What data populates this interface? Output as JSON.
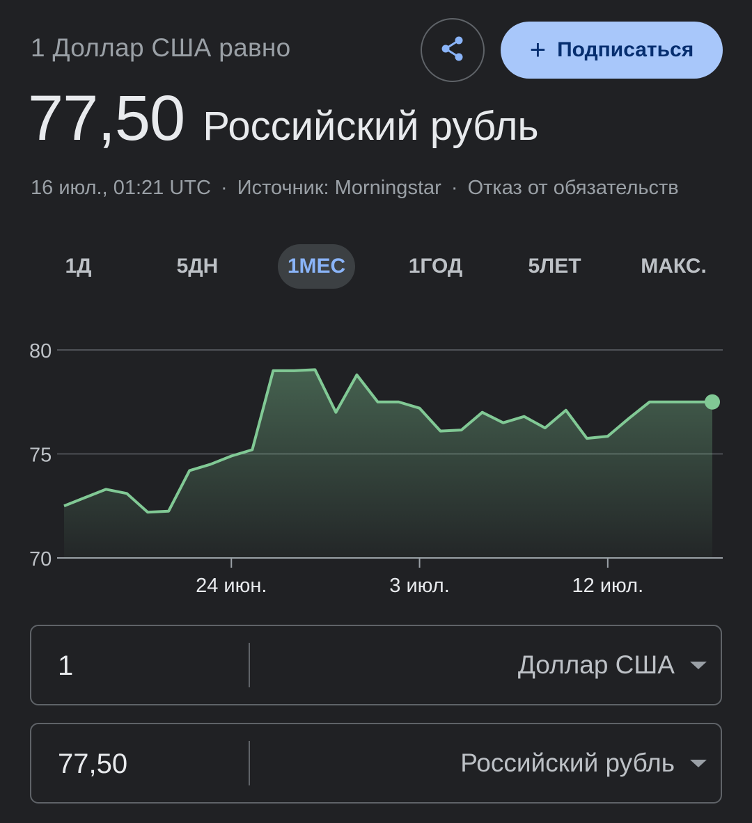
{
  "header": {
    "subtitle": "1 Доллар США равно",
    "rate": "77,50",
    "currency": "Российский рубль",
    "subscribe_label": "Подписаться",
    "share_icon": "share-icon"
  },
  "meta": {
    "timestamp": "16 июл., 01:21 UTC",
    "source": "Источник: Morningstar",
    "disclaimer": "Отказ от обязательств",
    "separator": "·"
  },
  "tabs": [
    {
      "label": "1Д",
      "active": false
    },
    {
      "label": "5ДН",
      "active": false
    },
    {
      "label": "1МЕС",
      "active": true
    },
    {
      "label": "1ГОД",
      "active": false
    },
    {
      "label": "5ЛЕТ",
      "active": false
    },
    {
      "label": "МАКС.",
      "active": false
    }
  ],
  "chart_data": {
    "type": "area",
    "x": [
      "15.06",
      "16.06",
      "17.06",
      "18.06",
      "19.06",
      "20.06",
      "21.06",
      "22.06",
      "23.06",
      "24.06",
      "25.06",
      "26.06",
      "27.06",
      "28.06",
      "29.06",
      "30.06",
      "01.07",
      "02.07",
      "03.07",
      "04.07",
      "05.07",
      "06.07",
      "07.07",
      "08.07",
      "09.07",
      "10.07",
      "11.07",
      "12.07",
      "13.07",
      "14.07",
      "15.07",
      "16.07"
    ],
    "y": [
      72.5,
      72.9,
      73.3,
      73.1,
      72.2,
      72.25,
      74.2,
      74.5,
      74.9,
      75.2,
      79.0,
      79.0,
      79.05,
      77.0,
      78.8,
      77.5,
      77.5,
      77.2,
      76.1,
      76.15,
      77.0,
      76.5,
      76.8,
      76.25,
      77.1,
      75.75,
      75.85,
      76.7,
      77.5,
      77.5,
      77.5,
      77.5
    ],
    "xticks": [
      "24 июн.",
      "3 июл.",
      "12 июл."
    ],
    "xtick_positions": [
      "23.06",
      "02.07",
      "11.07"
    ],
    "yticks": [
      70,
      75,
      80
    ],
    "ylim": [
      70,
      80
    ],
    "grid": true,
    "series_color": "#81c995",
    "last_point_marker": true
  },
  "converter": {
    "from_amount": "1",
    "from_currency": "Доллар США",
    "to_amount": "77,50",
    "to_currency": "Российский рубль"
  }
}
